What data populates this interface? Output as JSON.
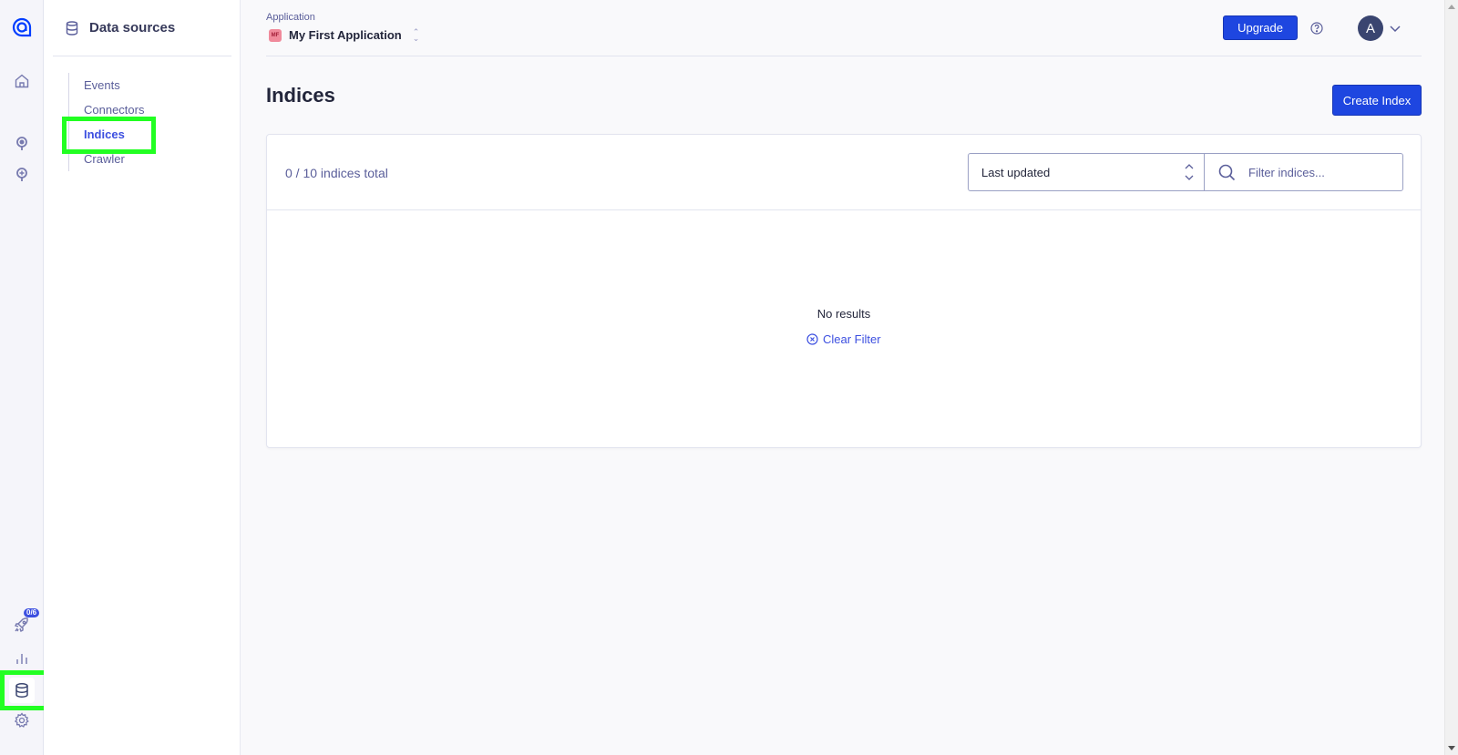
{
  "rail": {
    "icons": [
      "algolia-logo-icon",
      "home-icon",
      "search-pin-icon",
      "discovery-pin-icon",
      "rocket-icon",
      "chart-icon",
      "database-icon",
      "gear-icon"
    ],
    "onboarding_badge": "0/6"
  },
  "subnav": {
    "title": "Data sources",
    "items": [
      {
        "label": "Events"
      },
      {
        "label": "Connectors"
      },
      {
        "label": "Indices"
      },
      {
        "label": "Crawler"
      }
    ]
  },
  "header": {
    "app_label": "Application",
    "app_initials": "MF",
    "app_name": "My First Application",
    "upgrade_label": "Upgrade",
    "user_initial": "A"
  },
  "main": {
    "title": "Indices",
    "create_label": "Create Index",
    "count_text": "0 / 10 indices total",
    "sort_value": "Last updated",
    "filter_placeholder": "Filter indices...",
    "empty_text": "No results",
    "clear_label": "Clear Filter"
  },
  "colors": {
    "accent": "#1e46e0",
    "highlight": "#22ff22",
    "link": "#3c4fe0"
  }
}
